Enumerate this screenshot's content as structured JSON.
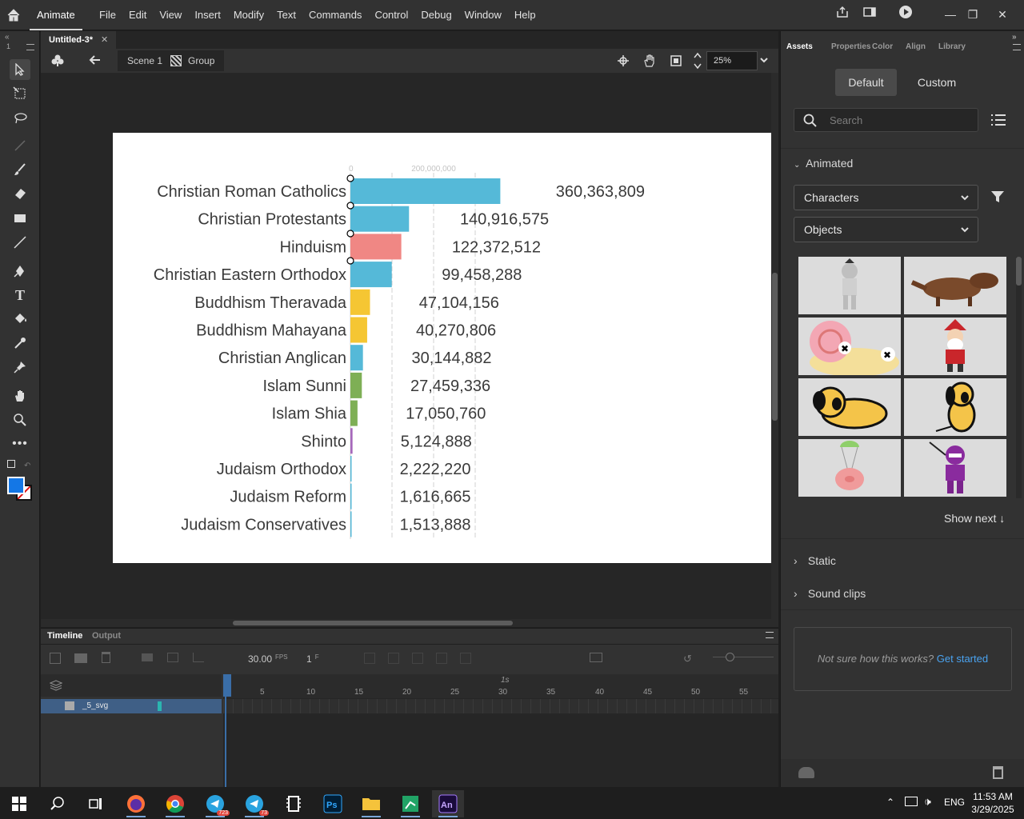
{
  "app": {
    "name": "Animate",
    "menus": [
      "File",
      "Edit",
      "View",
      "Insert",
      "Modify",
      "Text",
      "Commands",
      "Control",
      "Debug",
      "Window",
      "Help"
    ]
  },
  "document": {
    "tab_title": "Untitled-3*",
    "breadcrumb": [
      "Scene 1",
      "Group"
    ],
    "zoom": "25%"
  },
  "stage_chart": {
    "axis_ticks": [
      "0",
      "200,000,000"
    ],
    "colors": {
      "blue": "#55b9d8",
      "pink": "#f08784",
      "yellow": "#f5c633",
      "green": "#7eaf55",
      "purple": "#a668bb"
    }
  },
  "chart_data": {
    "type": "bar",
    "orientation": "horizontal",
    "categories": [
      "Christian Roman Catholics",
      "Christian Protestants",
      "Hinduism",
      "Christian Eastern Orthodox",
      "Buddhism Theravada",
      "Buddhism Mahayana",
      "Christian Anglican",
      "Islam Sunni",
      "Islam Shia",
      "Shinto",
      "Judaism Orthodox",
      "Judaism Reform",
      "Judaism Conservatives"
    ],
    "values": [
      360363809,
      140916575,
      122372512,
      99458288,
      47104156,
      40270806,
      30144882,
      27459336,
      17050760,
      5124888,
      2222220,
      1616665,
      1513888
    ],
    "value_labels": [
      "360,363,809",
      "140,916,575",
      "122,372,512",
      "99,458,288",
      "47,104,156",
      "40,270,806",
      "30,144,882",
      "27,459,336",
      "17,050,760",
      "5,124,888",
      "2,222,220",
      "1,616,665",
      "1,513,888"
    ],
    "colors": [
      "blue",
      "blue",
      "pink",
      "blue",
      "yellow",
      "yellow",
      "blue",
      "green",
      "green",
      "purple",
      "blue",
      "blue",
      "blue"
    ],
    "xlim": [
      0,
      400000000
    ],
    "grid": true
  },
  "timeline": {
    "tabs": [
      "Timeline",
      "Output"
    ],
    "fps": "30.00",
    "fps_unit": "FPS",
    "frame": "1",
    "frame_unit": "F",
    "layer_name": "_5_svg",
    "time_marker": "1s",
    "ruler_numbers": [
      "5",
      "10",
      "15",
      "20",
      "25",
      "30",
      "35",
      "40",
      "45",
      "50",
      "55"
    ]
  },
  "panel": {
    "tabs": [
      "Assets",
      "Properties",
      "Color",
      "Align",
      "Library"
    ],
    "segments": [
      "Default",
      "Custom"
    ],
    "search_placeholder": "Search",
    "animated_label": "Animated",
    "dropdown_characters": "Characters",
    "dropdown_objects": "Objects",
    "show_next": "Show next",
    "static_label": "Static",
    "sound_clips_label": "Sound clips",
    "hint_text": "Not sure how this works?",
    "hint_link": "Get started"
  },
  "taskbar": {
    "telegram_badge_1": "723",
    "telegram_badge_2": "73",
    "lang": "ENG",
    "time": "11:53 AM",
    "date": "3/29/2025"
  }
}
